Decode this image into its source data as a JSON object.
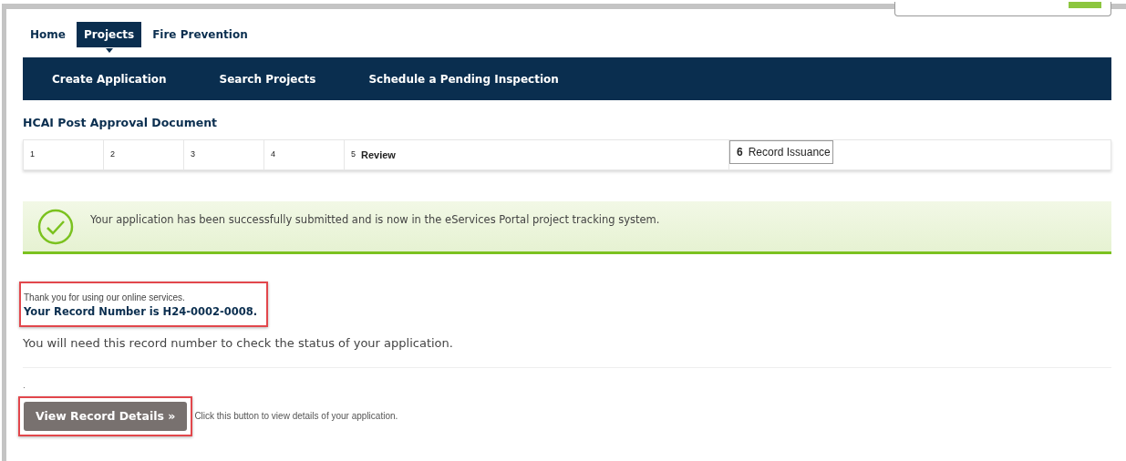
{
  "top_tabs": [
    {
      "label": "Home",
      "selected": false
    },
    {
      "label": "Projects",
      "selected": true
    },
    {
      "label": "Fire Prevention",
      "selected": false
    }
  ],
  "sub_nav": [
    "Create Application",
    "Search Projects",
    "Schedule a Pending Inspection"
  ],
  "page_title": "HCAI Post Approval Document",
  "steps": [
    {
      "number": "1",
      "selected": false
    },
    {
      "number": "2",
      "selected": false
    },
    {
      "number": "3",
      "selected": false
    },
    {
      "number": "4",
      "selected": false
    },
    {
      "number": "5",
      "label": "Review",
      "selected": false
    },
    {
      "number": "6",
      "label": "Record Issuance",
      "selected": true
    }
  ],
  "success_message": "Your application has been successfully submitted and is now in the eServices Portal project tracking system.",
  "thanks_text": "Thank you for using our online services.",
  "record_number_text": "Your Record Number is H24-0002-0008.",
  "info_text": "You will need this record number to check the status of your application.",
  "dot_text": ".",
  "view_button": "View Record Details »",
  "button_hint": "Click this button to view details of your application."
}
